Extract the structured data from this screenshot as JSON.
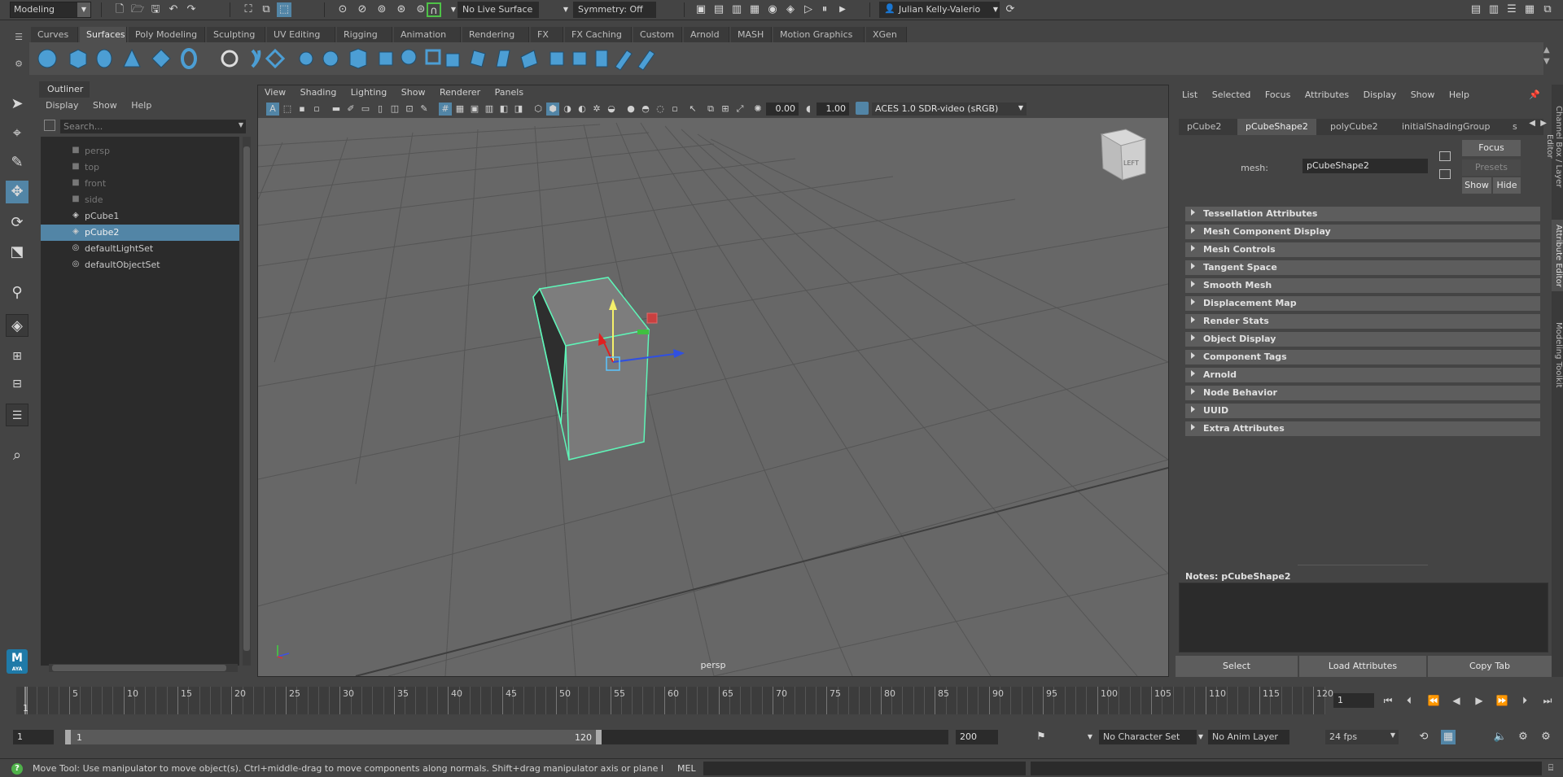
{
  "statusline": {
    "mode": "Modeling",
    "live_surface": "No Live Surface",
    "symmetry": "Symmetry: Off",
    "user": "Julian Kelly-Valerio"
  },
  "shelf": {
    "tabs": [
      "Curves",
      "Surfaces",
      "Poly Modeling",
      "Sculpting",
      "UV Editing",
      "Rigging",
      "Animation",
      "Rendering",
      "FX",
      "FX Caching",
      "Custom",
      "Arnold",
      "MASH",
      "Motion Graphics",
      "XGen"
    ],
    "active_tab": "Surfaces"
  },
  "outliner": {
    "title": "Outliner",
    "menu": [
      "Display",
      "Show",
      "Help"
    ],
    "search_placeholder": "Search...",
    "items": [
      {
        "label": "persp",
        "icon": "camera-icon",
        "dim": true
      },
      {
        "label": "top",
        "icon": "camera-icon",
        "dim": true
      },
      {
        "label": "front",
        "icon": "camera-icon",
        "dim": true
      },
      {
        "label": "side",
        "icon": "camera-icon",
        "dim": true
      },
      {
        "label": "pCube1",
        "icon": "mesh-icon",
        "dim": false
      },
      {
        "label": "pCube2",
        "icon": "mesh-icon",
        "dim": false,
        "selected": true
      },
      {
        "label": "defaultLightSet",
        "icon": "set-icon",
        "dim": false
      },
      {
        "label": "defaultObjectSet",
        "icon": "set-icon",
        "dim": false
      }
    ]
  },
  "viewport": {
    "menu": [
      "View",
      "Shading",
      "Lighting",
      "Show",
      "Renderer",
      "Panels"
    ],
    "exposure": "0.00",
    "gamma": "1.00",
    "color_transform": "ACES 1.0 SDR-video (sRGB)",
    "camera_label": "persp",
    "viewcube_label": "LEFT"
  },
  "attribute_editor": {
    "menu": [
      "List",
      "Selected",
      "Focus",
      "Attributes",
      "Display",
      "Show",
      "Help"
    ],
    "tabs": [
      "pCube2",
      "pCubeShape2",
      "polyCube2",
      "initialShadingGroup",
      "s"
    ],
    "active_tab": "pCubeShape2",
    "mesh_label": "mesh:",
    "mesh_value": "pCubeShape2",
    "focus_btn": "Focus",
    "presets_btn": "Presets",
    "show_btn": "Show",
    "hide_btn": "Hide",
    "sections": [
      "Tessellation Attributes",
      "Mesh Component Display",
      "Mesh Controls",
      "Tangent Space",
      "Smooth Mesh",
      "Displacement Map",
      "Render Stats",
      "Object Display",
      "Component Tags",
      "Arnold",
      "Node Behavior",
      "UUID",
      "Extra Attributes"
    ],
    "notes_label": "Notes:  pCubeShape2",
    "bottom_buttons": [
      "Select",
      "Load Attributes",
      "Copy Tab"
    ]
  },
  "side_tabs": [
    "Channel Box / Layer Editor",
    "Attribute Editor",
    "Modeling Toolkit"
  ],
  "timeslider": {
    "ticks": [
      "5",
      "10",
      "15",
      "20",
      "25",
      "30",
      "35",
      "40",
      "45",
      "50",
      "55",
      "60",
      "65",
      "70",
      "75",
      "80",
      "85",
      "90",
      "95",
      "100",
      "105",
      "110",
      "115",
      "120"
    ],
    "current_frame_label": "1",
    "current_frame_field": "1"
  },
  "rangeslider": {
    "start_time": "1",
    "range_start": "1",
    "range_end": "120",
    "end_time": "200",
    "character_set": "No Character Set",
    "anim_layer": "No Anim Layer",
    "fps": "24 fps"
  },
  "helpline": {
    "text": "Move Tool: Use manipulator to move object(s). Ctrl+middle-drag to move components along normals. Shift+drag manipulator axis or plane handles to extrude components or c",
    "mel_label": "MEL"
  },
  "logo": {
    "text": "M",
    "sub": "AYA"
  },
  "colors": {
    "accent": "#5285a6",
    "selection_wire": "#5ff5b8",
    "help_icon": "#4fb24a"
  }
}
